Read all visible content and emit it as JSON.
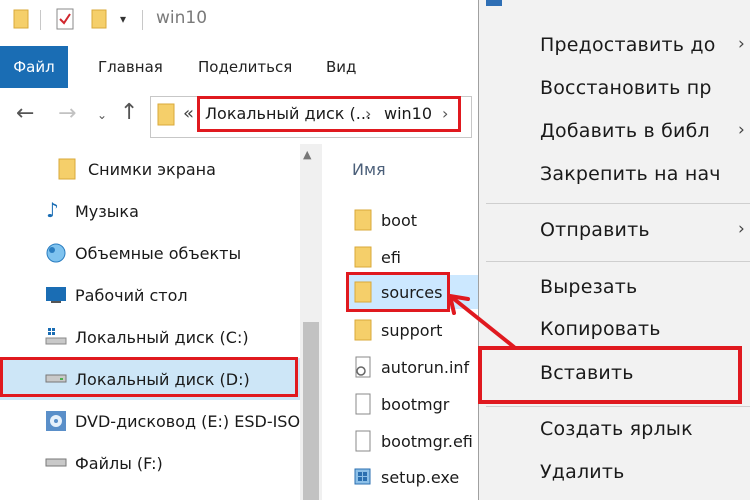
{
  "window": {
    "title": "win10",
    "qa_dropdown": "▾"
  },
  "ribbon": {
    "tabs": [
      "Файл",
      "Главная",
      "Поделиться",
      "Вид"
    ]
  },
  "address": {
    "overflow": "«",
    "crumbs": [
      "Локальный диск (...",
      "win10"
    ],
    "sep": "›"
  },
  "navpane": {
    "items": [
      {
        "label": "Снимки экрана",
        "icon": "folder-icon"
      },
      {
        "label": "Музыка",
        "icon": "music-icon"
      },
      {
        "label": "Объемные объекты",
        "icon": "3d-objects-icon"
      },
      {
        "label": "Рабочий стол",
        "icon": "desktop-icon"
      },
      {
        "label": "Локальный диск (C:)",
        "icon": "drive-os-icon"
      },
      {
        "label": "Локальный диск (D:)",
        "icon": "drive-icon",
        "selected": true
      },
      {
        "label": "DVD-дисковод (E:) ESD-ISO",
        "icon": "dvd-icon"
      },
      {
        "label": "Файлы (F:)",
        "icon": "drive-icon"
      }
    ]
  },
  "filelist": {
    "column_name": "Имя",
    "files": [
      {
        "name": "boot",
        "icon": "folder-icon"
      },
      {
        "name": "efi",
        "icon": "folder-icon"
      },
      {
        "name": "sources",
        "icon": "folder-icon",
        "selected": true
      },
      {
        "name": "support",
        "icon": "folder-icon"
      },
      {
        "name": "autorun.inf",
        "icon": "settings-file-icon"
      },
      {
        "name": "bootmgr",
        "icon": "file-icon"
      },
      {
        "name": "bootmgr.efi",
        "icon": "file-icon"
      },
      {
        "name": "setup.exe",
        "icon": "setup-icon"
      }
    ]
  },
  "context_menu": {
    "items": [
      "Предоставить до",
      "Восстановить пр",
      "Добавить в библ",
      "Закрепить на нач",
      "Отправить",
      "Вырезать",
      "Копировать",
      "Вставить",
      "Создать ярлык",
      "Удалить"
    ],
    "submenu_arrow": "›"
  },
  "colors": {
    "accent": "#1a6db4",
    "highlight_red": "#e0191f",
    "selection": "#cce8ff",
    "menu_bg": "#f2f2f2"
  }
}
